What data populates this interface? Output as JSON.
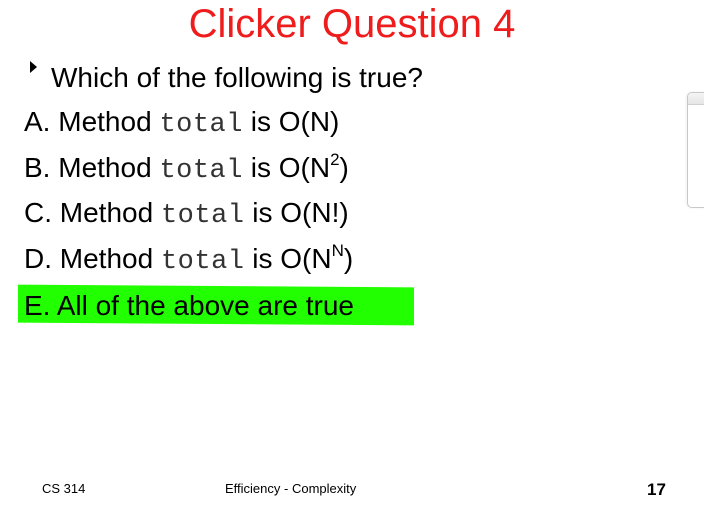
{
  "slide": {
    "title": "Clicker Question 4",
    "question": "Which of the following is true?",
    "options": [
      {
        "letter": "A.",
        "prefix": "Method",
        "code": "total",
        "suffix": "is O(N)",
        "sup": "",
        "close": ""
      },
      {
        "letter": "B.",
        "prefix": "Method",
        "code": "total",
        "suffix": "is O(N",
        "sup": "2",
        "close": ")"
      },
      {
        "letter": "C.",
        "prefix": "Method",
        "code": "total",
        "suffix": "is O(N!)",
        "sup": "",
        "close": ""
      },
      {
        "letter": "D.",
        "prefix": "Method",
        "code": "total",
        "suffix": "is O(N",
        "sup": "N",
        "close": ")"
      },
      {
        "letter": "E.",
        "text": "All of the above are true",
        "highlight_color": "#22ff00"
      }
    ],
    "footer": {
      "course": "CS 314",
      "topic": "Efficiency - Complexity",
      "page_number": "17"
    },
    "colors": {
      "title": "#ee1c1c",
      "text": "#000000",
      "highlight": "#22ff00"
    }
  }
}
